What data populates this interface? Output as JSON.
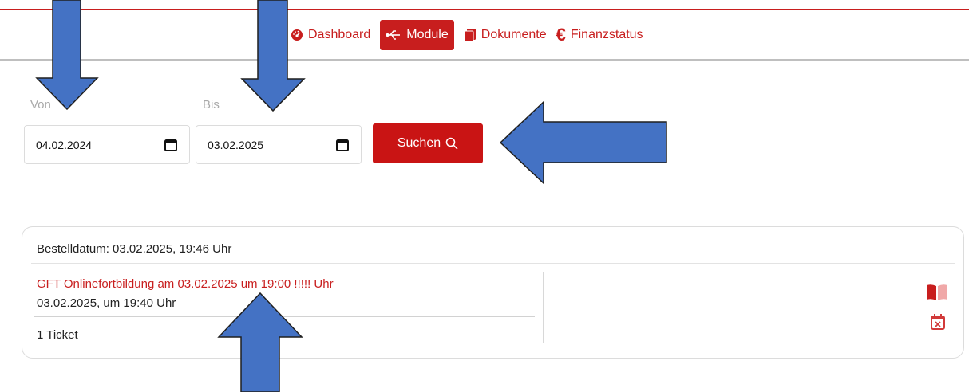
{
  "nav": {
    "items": [
      {
        "label": "Dashboard",
        "icon": "gauge-icon",
        "active": false
      },
      {
        "label": "Module",
        "icon": "usb-icon",
        "active": true
      },
      {
        "label": "Dokumente",
        "icon": "document-icon",
        "active": false
      },
      {
        "label": "Finanzstatus",
        "icon": "euro-icon",
        "active": false
      }
    ]
  },
  "filter": {
    "from_label": "Von",
    "from_value": "04.02.2024",
    "to_label": "Bis",
    "to_value": "03.02.2025",
    "search_label": "Suchen"
  },
  "orders": [
    {
      "order_date": "Bestelldatum: 03.02.2025, 19:46 Uhr",
      "course_title": "GFT Onlinefortbildung am 03.02.2025 um 19:00 !!!!! Uhr",
      "course_time": "03.02.2025, um 19:40 Uhr",
      "tickets": "1 Ticket"
    }
  ],
  "colors": {
    "brand": "#c81e1e",
    "button": "#c91414",
    "annotation_arrow": "#4472c4",
    "annotation_arrow_outline": "#1f1f1f"
  },
  "icons": [
    "gauge-icon",
    "usb-icon",
    "document-icon",
    "euro-icon",
    "calendar-icon",
    "search-icon",
    "book-icon",
    "calendar-cancel-icon",
    "arrow-down-annotation",
    "arrow-up-annotation",
    "arrow-left-annotation"
  ]
}
